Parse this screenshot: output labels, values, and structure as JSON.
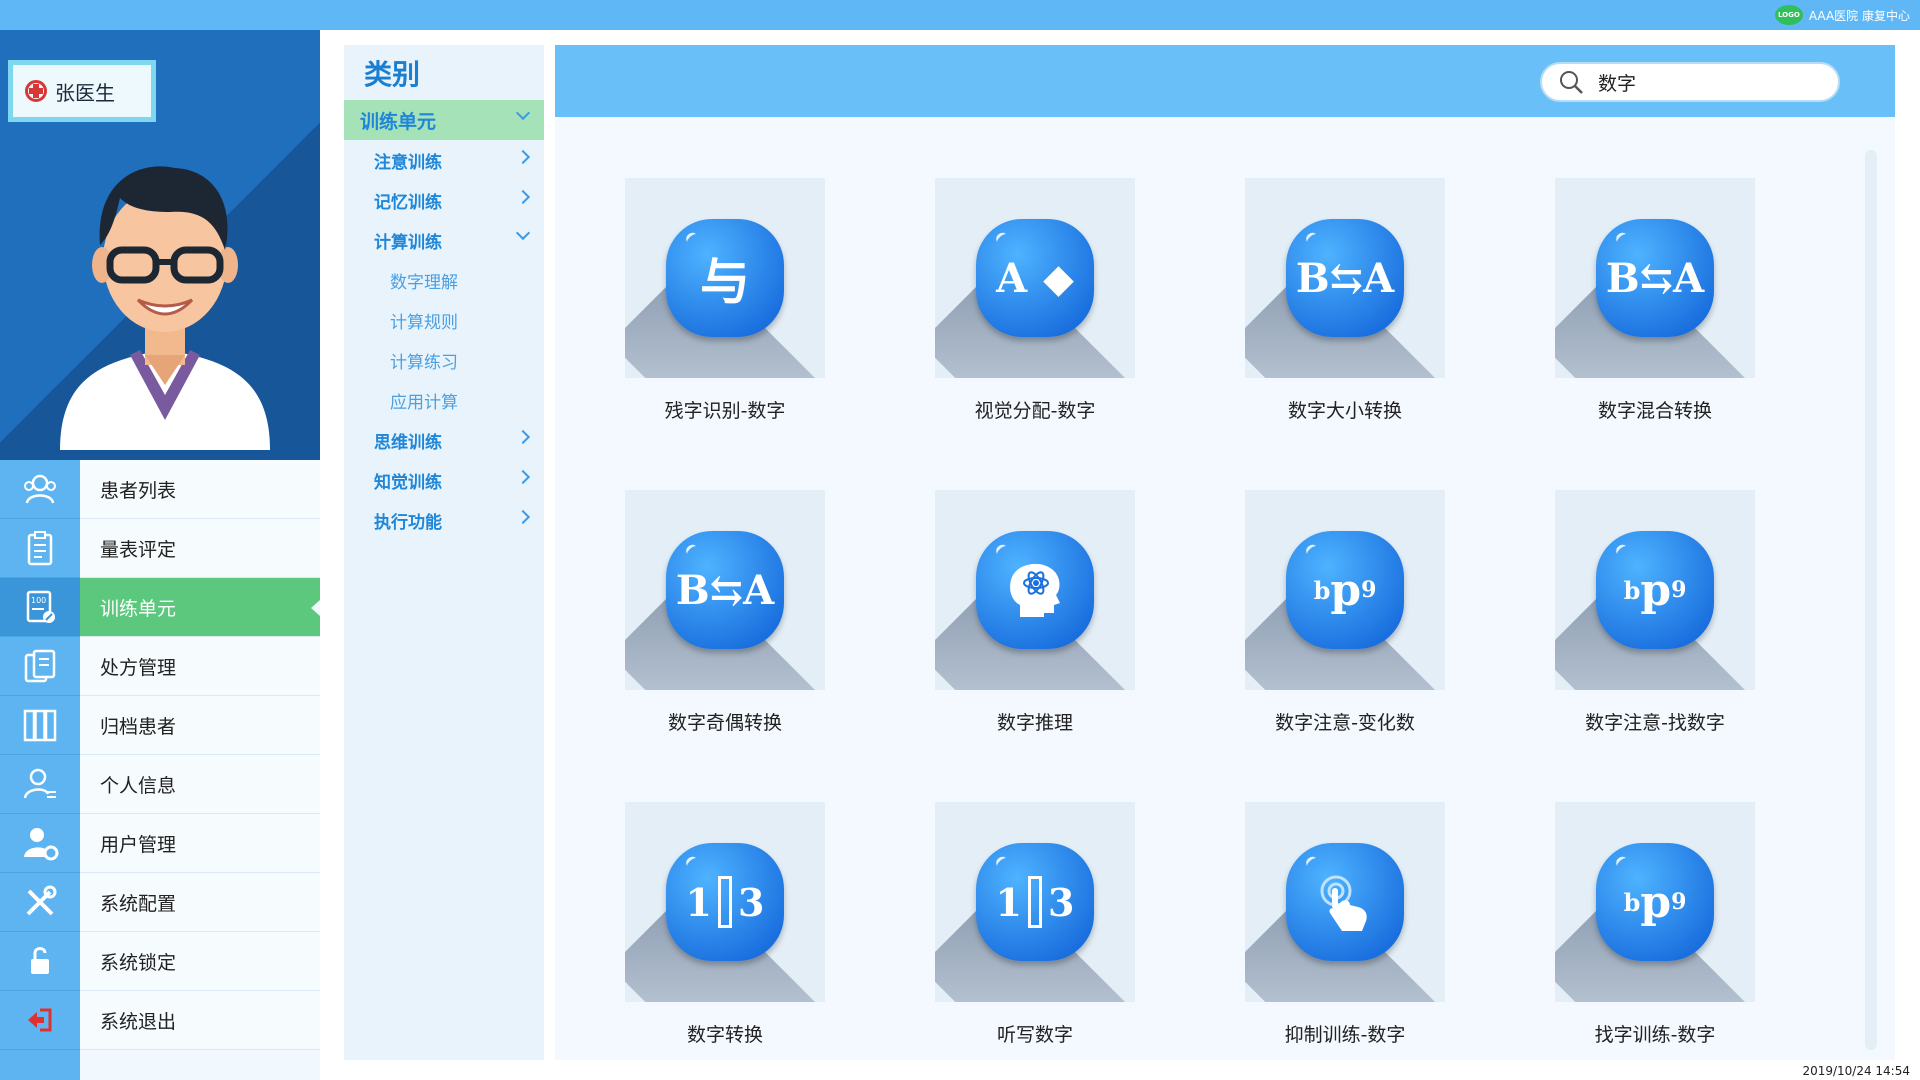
{
  "top_bar": {
    "logo_text": "LOGO",
    "brand": "AAA医院  康复中心"
  },
  "user": {
    "name": "张医生"
  },
  "nav": {
    "items": [
      {
        "label": "患者列表",
        "icon": "users-icon"
      },
      {
        "label": "量表评定",
        "icon": "clipboard-icon"
      },
      {
        "label": "训练单元",
        "icon": "score-sheet-icon",
        "active": true
      },
      {
        "label": "处方管理",
        "icon": "prescription-icon"
      },
      {
        "label": "归档患者",
        "icon": "archive-icon"
      },
      {
        "label": "个人信息",
        "icon": "person-icon"
      },
      {
        "label": "用户管理",
        "icon": "user-settings-icon"
      },
      {
        "label": "系统配置",
        "icon": "tools-icon"
      },
      {
        "label": "系统锁定",
        "icon": "unlock-icon"
      },
      {
        "label": "系统退出",
        "icon": "exit-icon"
      }
    ]
  },
  "category": {
    "title": "类别",
    "unit": "训练单元",
    "groups": [
      {
        "label": "注意训练"
      },
      {
        "label": "记忆训练"
      },
      {
        "label": "计算训练",
        "expanded": true,
        "children": [
          "数字理解",
          "计算规则",
          "计算练习",
          "应用计算"
        ]
      },
      {
        "label": "思维训练"
      },
      {
        "label": "知觉训练"
      },
      {
        "label": "执行功能"
      }
    ]
  },
  "search": {
    "value": "数字"
  },
  "cards": [
    {
      "label": "残字识别-数字",
      "glyph": "与"
    },
    {
      "label": "视觉分配-数字",
      "glyph": "A ◆"
    },
    {
      "label": "数字大小转换",
      "glyph": "B⇆A"
    },
    {
      "label": "数字混合转换",
      "glyph": "B⇆A"
    },
    {
      "label": "数字奇偶转换",
      "glyph": "B⇆A"
    },
    {
      "label": "数字推理",
      "glyph": "head"
    },
    {
      "label": "数字注意-变化数",
      "glyph": "bp6"
    },
    {
      "label": "数字注意-找数字",
      "glyph": "bp6"
    },
    {
      "label": "数字转换",
      "glyph": "1|3"
    },
    {
      "label": "听写数字",
      "glyph": "1|3"
    },
    {
      "label": "抑制训练-数字",
      "glyph": "hand"
    },
    {
      "label": "找字训练-数字",
      "glyph": "bp6"
    }
  ],
  "timestamp": "2019/10/24 14:54",
  "colors": {
    "top_bar": "#5fb8f5",
    "active_nav": "#5cc87d",
    "header": "#69bff8",
    "accent": "#1a7fd1"
  }
}
